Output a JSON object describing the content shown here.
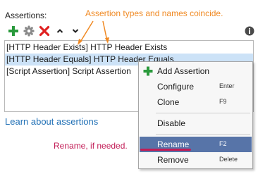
{
  "panel": {
    "title": "Assertions:"
  },
  "toolbar": {
    "buttons": [
      {
        "name": "add",
        "icon": "plus-icon",
        "color": "#2a9a3c"
      },
      {
        "name": "settings",
        "icon": "gear-icon",
        "color": "#8a8a8a"
      },
      {
        "name": "delete",
        "icon": "x-icon",
        "color": "#e02020"
      },
      {
        "name": "move-up",
        "icon": "chevron-up-icon",
        "color": "#222222"
      },
      {
        "name": "move-down",
        "icon": "chevron-down-icon",
        "color": "#222222"
      }
    ],
    "info_icon": "info-icon"
  },
  "assertions": [
    {
      "label": "[HTTP Header Exists] HTTP Header Exists",
      "selected": false
    },
    {
      "label": "[HTTP Header Equals] HTTP Header Equals",
      "selected": true
    },
    {
      "label": "[Script Assertion] Script Assertion",
      "selected": false
    }
  ],
  "link": {
    "label": "Learn about assertions"
  },
  "annotations": {
    "top": "Assertion types and names coincide.",
    "rename": "Rename, if needed.",
    "top_color": "#f08a24",
    "rename_color": "#c21c56"
  },
  "context_menu": {
    "items": [
      {
        "label": "Add Assertion",
        "shortcut": "",
        "icon": "plus-icon",
        "highlighted": false
      },
      {
        "label": "Configure",
        "shortcut": "Enter",
        "icon": "",
        "highlighted": false
      },
      {
        "label": "Clone",
        "shortcut": "F9",
        "icon": "",
        "highlighted": false
      },
      {
        "label": "Disable",
        "shortcut": "",
        "icon": "",
        "highlighted": false
      },
      {
        "label": "Rename",
        "shortcut": "F2",
        "icon": "",
        "highlighted": true
      },
      {
        "label": "Remove",
        "shortcut": "Delete",
        "icon": "",
        "highlighted": false
      }
    ],
    "highlight_color": "#5774a8"
  }
}
